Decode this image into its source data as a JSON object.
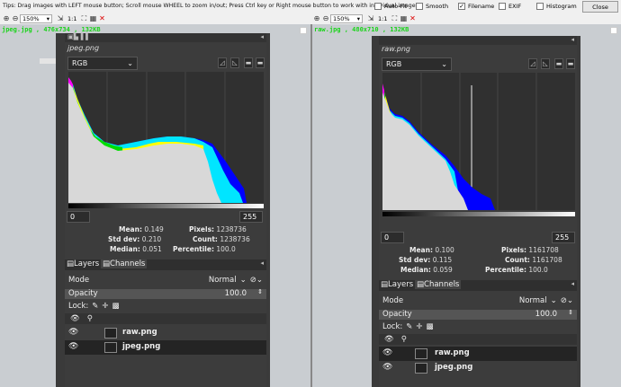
{
  "tips": "Tips: Drag images with LEFT mouse button; Scroll mouse WHEEL to zoom in/out; Press Ctrl key or Right mouse button to work with individual images.",
  "options": {
    "autofit": {
      "label": "Auto-Fit",
      "checked": false
    },
    "smooth": {
      "label": "Smooth",
      "checked": false
    },
    "filename": {
      "label": "Filename",
      "checked": true
    },
    "exif": {
      "label": "EXIF",
      "checked": false
    },
    "histogram": {
      "label": "Histogram",
      "checked": false
    }
  },
  "close_label": "Close",
  "left": {
    "zoom": "150%",
    "ratio": "1:1",
    "title": "jpeg.jpg , 476x734 , 132KB",
    "image_name": "jpeg.png",
    "channel": "RGB",
    "range_min": "0",
    "range_max": "255",
    "stats": {
      "mean_label": "Mean:",
      "mean": "0.149",
      "stddev_label": "Std dev:",
      "stddev": "0.210",
      "median_label": "Median:",
      "median": "0.051",
      "pixels_label": "Pixels:",
      "pixels": "1238736",
      "count_label": "Count:",
      "count": "1238736",
      "percentile_label": "Percentile:",
      "percentile": "100.0"
    },
    "tabs": {
      "layers": "Layers",
      "channels": "Channels"
    },
    "mode_label": "Mode",
    "mode_value": "Normal",
    "opacity_label": "Opacity",
    "opacity_value": "100.0",
    "lock_label": "Lock:",
    "layers": [
      "raw.png",
      "jpeg.png"
    ]
  },
  "right": {
    "zoom": "150%",
    "ratio": "1:1",
    "title": "raw.jpg , 480x710 , 132KB",
    "image_name": "raw.png",
    "channel": "RGB",
    "range_min": "0",
    "range_max": "255",
    "stats": {
      "mean_label": "Mean:",
      "mean": "0.100",
      "stddev_label": "Std dev:",
      "stddev": "0.115",
      "median_label": "Median:",
      "median": "0.059",
      "pixels_label": "Pixels:",
      "pixels": "1161708",
      "count_label": "Count:",
      "count": "1161708",
      "percentile_label": "Percentile:",
      "percentile": "100.0"
    },
    "tabs": {
      "layers": "Layers",
      "channels": "Channels"
    },
    "mode_label": "Mode",
    "mode_value": "Normal",
    "opacity_label": "Opacity",
    "opacity_value": "100.0",
    "lock_label": "Lock:",
    "layers": [
      "raw.png",
      "jpeg.png"
    ]
  },
  "colors": {
    "title_green": "#1ad41a",
    "panel_bg": "#3c3c3c",
    "viewer_bg": "#c9cdd1"
  }
}
